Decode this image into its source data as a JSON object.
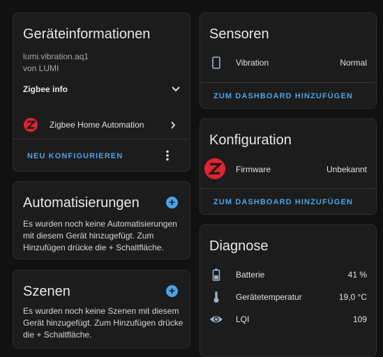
{
  "device": {
    "title": "Geräteinformationen",
    "model": "lumi.vibration.aq1",
    "manufacturer": "von LUMI",
    "zigbee_info_label": "Zigbee info",
    "integration_label": "Zigbee Home Automation",
    "reconfigure_label": "NEU KONFIGURIEREN"
  },
  "automations": {
    "title": "Automatisierungen",
    "text": "Es wurden noch keine Automatisierungen mit diesem Gerät hinzugefügt. Zum Hinzufügen drücke die + Schaltfläche."
  },
  "scenes": {
    "title": "Szenen",
    "text": "Es wurden noch keine Szenen mit diesem Gerät hinzugefügt. Zum Hinzufügen drücke die + Schaltfläche."
  },
  "sensors": {
    "title": "Sensoren",
    "rows": [
      {
        "label": "Vibration",
        "value": "Normal",
        "icon": "vibration-icon"
      }
    ],
    "add_label": "ZUM DASHBOARD HINZUFÜGEN"
  },
  "config": {
    "title": "Konfiguration",
    "rows": [
      {
        "label": "Firmware",
        "value": "Unbekannt",
        "icon": "zigbee-icon"
      }
    ],
    "add_label": "ZUM DASHBOARD HINZUFÜGEN"
  },
  "diagnostics": {
    "title": "Diagnose",
    "rows": [
      {
        "label": "Batterie",
        "value": "41 %",
        "icon": "battery-icon"
      },
      {
        "label": "Gerätetemperatur",
        "value": "19,0 °C",
        "icon": "thermometer-icon"
      },
      {
        "label": "LQI",
        "value": "109",
        "icon": "eye-icon"
      }
    ]
  },
  "colors": {
    "accent": "#4aa3e6",
    "zigbee": "#e2232e",
    "icon": "#9ab3c8"
  }
}
